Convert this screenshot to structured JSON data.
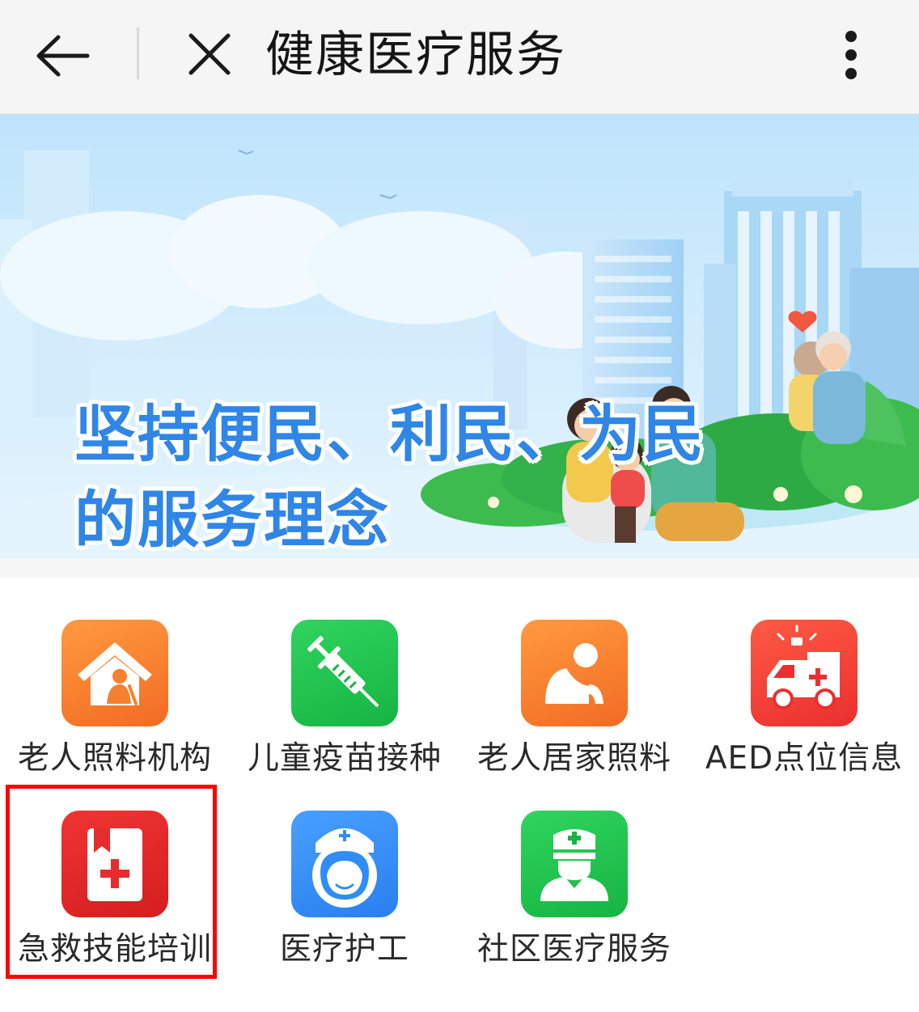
{
  "header": {
    "title": "健康医疗服务",
    "back_icon": "arrow-left-icon",
    "close_icon": "close-icon",
    "more_icon": "more-vertical-icon"
  },
  "banner": {
    "line1": "坚持便民、利民、为民",
    "line2": "的服务理念"
  },
  "services": [
    {
      "label": "老人照料机构",
      "icon": "elder-care-home-icon",
      "color": "#f97a2c"
    },
    {
      "label": "儿童疫苗接种",
      "icon": "syringe-icon",
      "color": "#1ec34a"
    },
    {
      "label": "老人居家照料",
      "icon": "elder-home-care-icon",
      "color": "#f97a2c"
    },
    {
      "label": "AED点位信息",
      "icon": "ambulance-icon",
      "color": "#f2433a"
    },
    {
      "label": "急救技能培训",
      "icon": "first-aid-book-icon",
      "color": "#e52d2d",
      "highlighted": true
    },
    {
      "label": "医疗护工",
      "icon": "nurse-icon",
      "color": "#2f8df5"
    },
    {
      "label": "社区医疗服务",
      "icon": "doctor-icon",
      "color": "#1ec34a"
    }
  ],
  "colors": {
    "header_bg": "#f5f5f5",
    "banner_text": "#2f86e6",
    "highlight": "#ff0000"
  }
}
